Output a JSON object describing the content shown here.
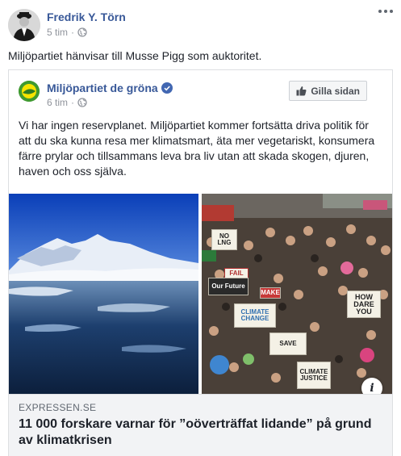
{
  "post": {
    "author": "Fredrik Y. Törn",
    "time": "5 tim",
    "text": "Miljöpartiet hänvisar till Musse Pigg som auktoritet."
  },
  "shared": {
    "page_name": "Miljöpartiet de gröna",
    "time": "6 tim",
    "like_page_label": "Gilla sidan",
    "text": "Vi har ingen reservplanet. Miljöpartiet kommer fortsätta driva politik för att du ska kunna resa mer klimatsmart, äta mer vegetariskt, konsumera färre prylar och tillsammans leva bra liv utan att skada skogen, djuren, haven och oss själva.",
    "link": {
      "domain": "EXPRESSEN.SE",
      "title": "11 000 forskare varnar för ”oöverträffat lidande” på grund av klimatkrisen"
    },
    "signs": [
      "NO LNG",
      "FAIL",
      "Our Future",
      "MAKE",
      "HOW DARE YOU",
      "CLIMATE JUSTICE",
      "SAVE",
      "CLIMATE CHANGE"
    ]
  },
  "colors": {
    "link_blue": "#385898",
    "meta_gray": "#90949c",
    "page_green": "#2e8b2e"
  }
}
